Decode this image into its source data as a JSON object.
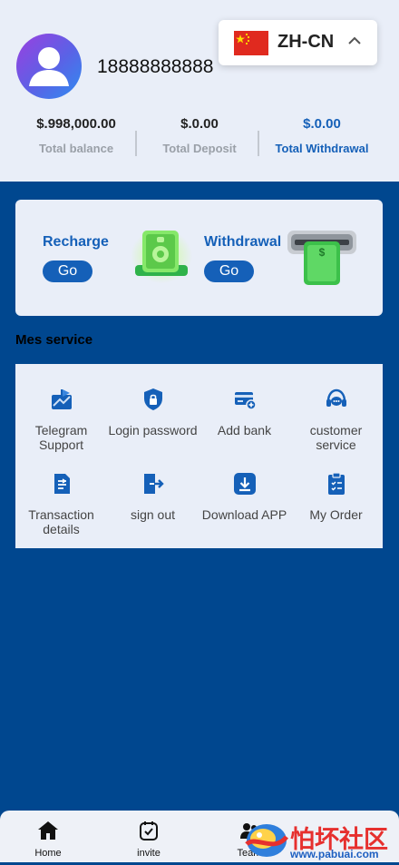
{
  "user": {
    "phone": "18888888888"
  },
  "language": {
    "label": "ZH-CN"
  },
  "stats": [
    {
      "value": "$.998,000.00",
      "label": "Total balance"
    },
    {
      "value": "$.0.00",
      "label": "Total Deposit"
    },
    {
      "value": "$.0.00",
      "label": "Total Withdrawal"
    }
  ],
  "actions": {
    "recharge": {
      "title": "Recharge",
      "button": "Go"
    },
    "withdrawal": {
      "title": "Withdrawal",
      "button": "Go"
    }
  },
  "services": {
    "title": "Mes service",
    "items": [
      {
        "label": "Telegram Support",
        "icon": "telegram-support-icon"
      },
      {
        "label": "Login password",
        "icon": "shield-lock-icon"
      },
      {
        "label": "Add bank",
        "icon": "bank-card-add-icon"
      },
      {
        "label": "customer service",
        "icon": "headset-icon"
      },
      {
        "label": "Transaction details",
        "icon": "document-icon"
      },
      {
        "label": "sign out",
        "icon": "sign-out-icon"
      },
      {
        "label": "Download APP",
        "icon": "download-icon"
      },
      {
        "label": "My Order",
        "icon": "clipboard-icon"
      }
    ]
  },
  "tabbar": {
    "items": [
      {
        "label": "Home",
        "icon": "home-icon"
      },
      {
        "label": "invite",
        "icon": "calendar-check-icon"
      },
      {
        "label": "Team",
        "icon": "team-icon"
      }
    ]
  },
  "watermark": {
    "title": "怕坏社区",
    "url": "www.pabuai.com"
  },
  "colors": {
    "primary": "#1560b8",
    "page_bg": "#00478f",
    "panel_bg": "#e9eef8"
  }
}
